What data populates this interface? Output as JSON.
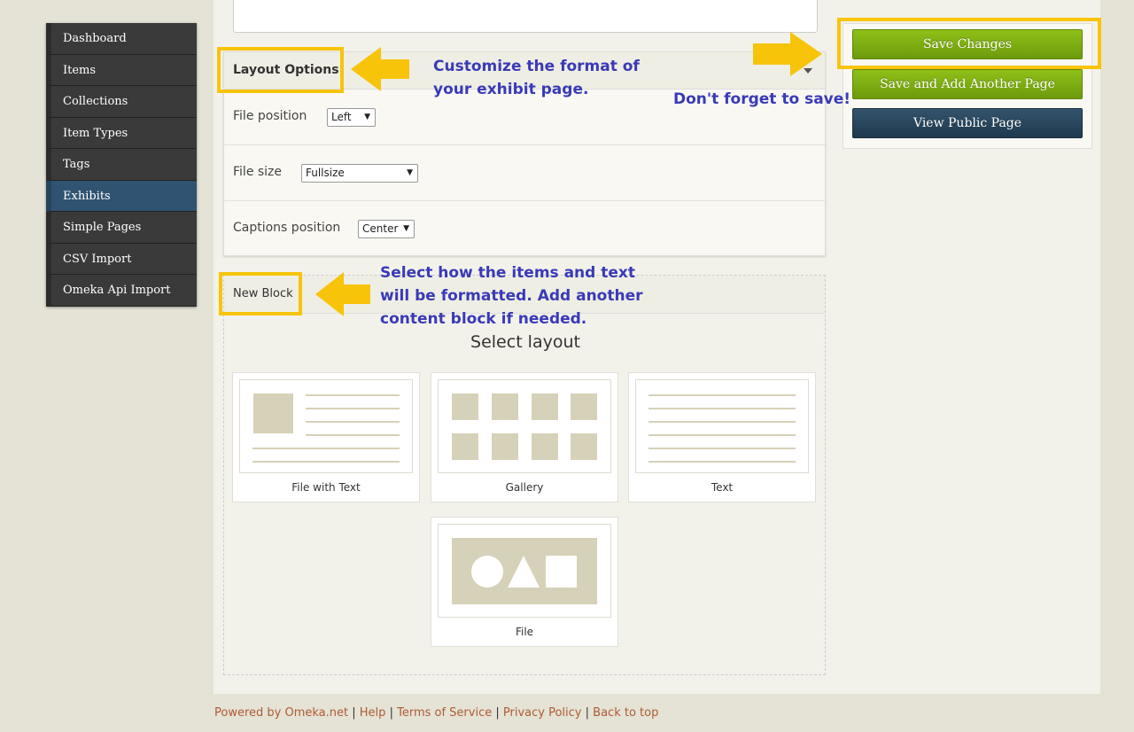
{
  "sidebar": {
    "items": [
      {
        "label": "Dashboard",
        "active": false
      },
      {
        "label": "Items",
        "active": false
      },
      {
        "label": "Collections",
        "active": false
      },
      {
        "label": "Item Types",
        "active": false
      },
      {
        "label": "Tags",
        "active": false
      },
      {
        "label": "Exhibits",
        "active": true
      },
      {
        "label": "Simple Pages",
        "active": false
      },
      {
        "label": "CSV Import",
        "active": false
      },
      {
        "label": "Omeka Api Import",
        "active": false
      }
    ]
  },
  "layout_options": {
    "title": "Layout Options",
    "file_position": {
      "label": "File position",
      "value": "Left"
    },
    "file_size": {
      "label": "File size",
      "value": "Fullsize"
    },
    "captions_position": {
      "label": "Captions position",
      "value": "Center"
    }
  },
  "new_block": {
    "title": "New Block",
    "select_layout": "Select layout",
    "layouts": [
      {
        "label": "File with Text"
      },
      {
        "label": "Gallery"
      },
      {
        "label": "Text"
      },
      {
        "label": "File"
      }
    ]
  },
  "actions": {
    "save_changes": "Save Changes",
    "save_and_add": "Save and Add Another Page",
    "view_public": "View Public Page"
  },
  "annotations": {
    "layout_options_note_line1": "Customize the format of",
    "layout_options_note_line2": "your exhibit page.",
    "save_note": "Don't forget to save!",
    "new_block_note_line1": "Select how the items and text",
    "new_block_note_line2": "will be formatted. Add another",
    "new_block_note_line3": "content block if needed.",
    "highlight_color": "#f7c40a",
    "text_color": "#3a3ab8"
  },
  "footer": {
    "powered_by": "Powered by Omeka.net",
    "help": "Help",
    "terms": "Terms of Service",
    "privacy": "Privacy Policy",
    "back_to_top": "Back to top",
    "separator": "|"
  }
}
